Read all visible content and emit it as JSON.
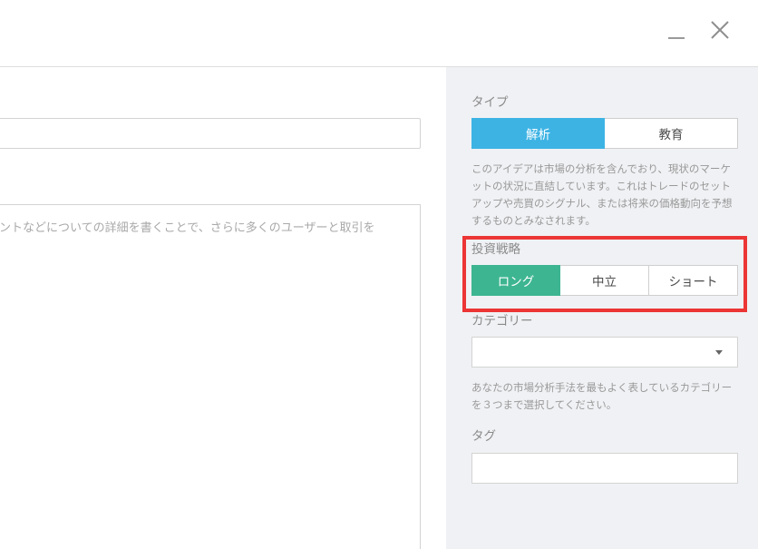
{
  "window": {
    "minimize_icon": "minimize-icon",
    "close_icon": "close-icon"
  },
  "main": {
    "title_placeholder": "",
    "description_placeholder": "ントなどについての詳細を書くことで、さらに多くのユーザーと取引を"
  },
  "sidebar": {
    "type": {
      "label": "タイプ",
      "options": [
        "解析",
        "教育"
      ],
      "selected": "解析",
      "help": "このアイデアは市場の分析を含んでおり、現状のマーケットの状況に直結しています。これはトレードのセットアップや売買のシグナル、または将来の価格動向を予想するものとみなされます。"
    },
    "strategy": {
      "label": "投資戦略",
      "options": [
        "ロング",
        "中立",
        "ショート"
      ],
      "selected": "ロング"
    },
    "category": {
      "label": "カテゴリー",
      "value": "",
      "help": "あなたの市場分析手法を最もよく表しているカテゴリーを３つまで選択してください。"
    },
    "tags": {
      "label": "タグ",
      "value": ""
    }
  },
  "colors": {
    "type_active": "#3db3e4",
    "strategy_active": "#3db591",
    "highlight": "#ec3535",
    "sidebar_bg": "#f0f1f4"
  }
}
